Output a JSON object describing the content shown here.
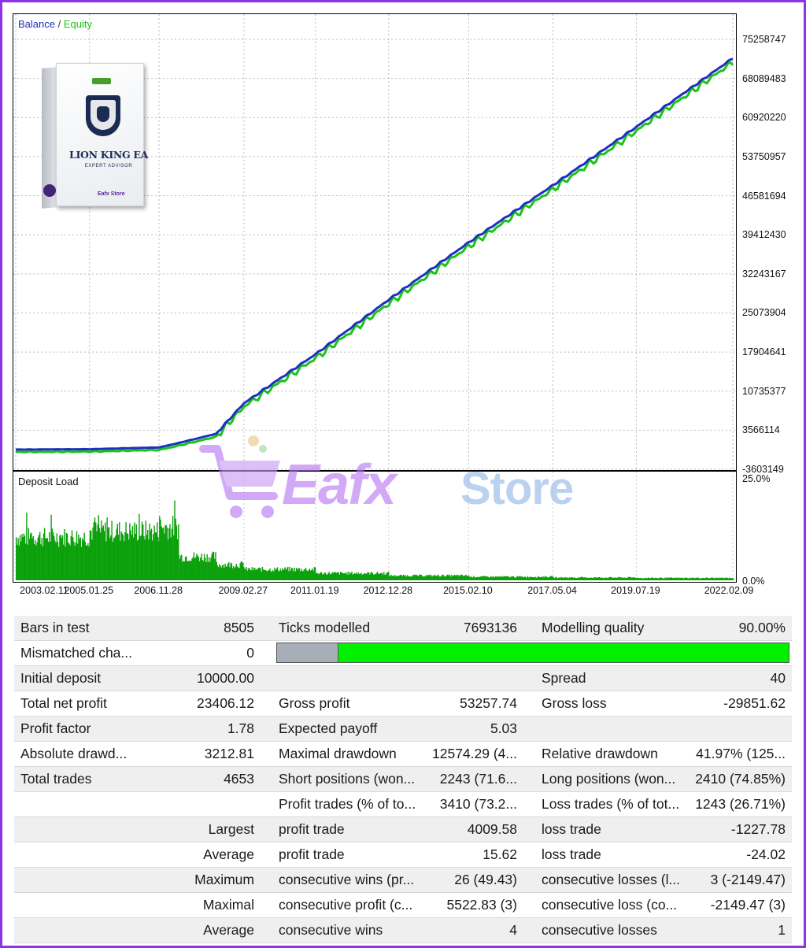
{
  "main_chart": {
    "legend": {
      "balance": "Balance",
      "separator": "/",
      "equity": "Equity"
    },
    "y_ticks": [
      "75258747",
      "68089483",
      "60920220",
      "53750957",
      "46581694",
      "39412430",
      "32243167",
      "25073904",
      "17904641",
      "10735377",
      "3566114",
      "-3603149"
    ],
    "colors": {
      "balance": "#1f2fbf",
      "equity": "#18c418"
    }
  },
  "chart_data": [
    {
      "type": "line",
      "title": "",
      "series": [
        {
          "name": "Balance",
          "x": [
            "2003.02.11",
            "2005.01.25",
            "2006.11.28",
            "2007.06",
            "2008.06",
            "2009.02.27",
            "2011.01.19",
            "2012.12.28",
            "2015.02.10",
            "2017.05.04",
            "2019.07.19",
            "2022.02.09"
          ],
          "values": [
            10000,
            80000,
            400000,
            1200000,
            2900000,
            8500000,
            17500000,
            27500000,
            38000000,
            48500000,
            59200000,
            71800000
          ]
        },
        {
          "name": "Equity",
          "x": [
            "2003.02.11",
            "2005.01.25",
            "2006.11.28",
            "2007.06",
            "2008.06",
            "2009.02.27",
            "2011.01.19",
            "2012.12.28",
            "2015.02.10",
            "2017.05.04",
            "2019.07.19",
            "2022.02.09"
          ],
          "values": [
            10000,
            80000,
            380000,
            1150000,
            2800000,
            8300000,
            17200000,
            27200000,
            37700000,
            48200000,
            58900000,
            71500000
          ]
        }
      ],
      "ylim": [
        -3603149,
        78000000
      ]
    },
    {
      "type": "bar",
      "title": "Deposit Load",
      "x_range": [
        "2003.02.11",
        "2022.02.09"
      ],
      "ylim": [
        0,
        25
      ],
      "y_ticks": [
        "25.0%",
        "0.0%"
      ],
      "segments_pct": [
        {
          "from": "2003.02.11",
          "to": "2005.01.25",
          "level": 11
        },
        {
          "from": "2005.01.25",
          "to": "2006.11.28",
          "level": 12.5
        },
        {
          "from": "2006.11.28",
          "to": "2007.06",
          "level": 13.5
        },
        {
          "from": "2007.06",
          "to": "2008.06",
          "level": 6
        },
        {
          "from": "2008.06",
          "to": "2009.02.27",
          "level": 4
        },
        {
          "from": "2009.02.27",
          "to": "2011.01.19",
          "level": 2.8
        },
        {
          "from": "2011.01.19",
          "to": "2012.12.28",
          "level": 1.8
        },
        {
          "from": "2012.12.28",
          "to": "2015.02.10",
          "level": 1.2
        },
        {
          "from": "2015.02.10",
          "to": "2017.05.04",
          "level": 0.9
        },
        {
          "from": "2017.05.04",
          "to": "2019.07.19",
          "level": 0.7
        },
        {
          "from": "2019.07.19",
          "to": "2022.02.09",
          "level": 0.6
        }
      ],
      "bar_color": "#0aa00a"
    }
  ],
  "deposit_load": {
    "legend": "Deposit Load",
    "y_ticks": [
      "25.0%",
      "0.0%"
    ]
  },
  "x_axis": [
    "2003.02.11",
    "2005.01.25",
    "2006.11.28",
    "2009.02.27",
    "2011.01.19",
    "2012.12.28",
    "2015.02.10",
    "2017.05.04",
    "2019.07.19",
    "2022.02.09"
  ],
  "product": {
    "title": "LION KING EA",
    "subtitle": "EXPERT ADVISOR",
    "brand": "Eafx Store"
  },
  "watermark": {
    "part1": "Eafx",
    "part2": "Store"
  },
  "stats": {
    "bars_in_test": {
      "label": "Bars in test",
      "value": "8505"
    },
    "ticks_modelled": {
      "label": "Ticks modelled",
      "value": "7693136"
    },
    "modelling_quality": {
      "label": "Modelling quality",
      "value": "90.00%"
    },
    "mismatched": {
      "label": "Mismatched cha...",
      "value": "0"
    },
    "quality_fraction": 0.9,
    "initial_deposit": {
      "label": "Initial deposit",
      "value": "10000.00"
    },
    "spread": {
      "label": "Spread",
      "value": "40"
    },
    "total_net_profit": {
      "label": "Total net profit",
      "value": "23406.12"
    },
    "gross_profit": {
      "label": "Gross profit",
      "value": "53257.74"
    },
    "gross_loss": {
      "label": "Gross loss",
      "value": "-29851.62"
    },
    "profit_factor": {
      "label": "Profit factor",
      "value": "1.78"
    },
    "expected_payoff": {
      "label": "Expected payoff",
      "value": "5.03"
    },
    "absolute_drawdown": {
      "label": "Absolute drawd...",
      "value": "3212.81"
    },
    "maximal_drawdown": {
      "label": "Maximal drawdown",
      "value": "12574.29 (4..."
    },
    "relative_drawdown": {
      "label": "Relative drawdown",
      "value": "41.97% (125..."
    },
    "total_trades": {
      "label": "Total trades",
      "value": "4653"
    },
    "short_positions": {
      "label": "Short positions (won...",
      "value": "2243 (71.6..."
    },
    "long_positions": {
      "label": "Long positions (won...",
      "value": "2410 (74.85%)"
    },
    "profit_trades": {
      "label": "Profit trades (% of to...",
      "value": "3410 (73.2..."
    },
    "loss_trades": {
      "label": "Loss trades (% of tot...",
      "value": "1243 (26.71%)"
    },
    "largest": {
      "label": "Largest",
      "profit_label": "profit trade",
      "profit_value": "4009.58",
      "loss_label": "loss trade",
      "loss_value": "-1227.78"
    },
    "average": {
      "label": "Average",
      "profit_label": "profit trade",
      "profit_value": "15.62",
      "loss_label": "loss trade",
      "loss_value": "-24.02"
    },
    "maximum": {
      "label": "Maximum",
      "profit_label": "consecutive wins (pr...",
      "profit_value": "26 (49.43)",
      "loss_label": "consecutive losses (l...",
      "loss_value": "3 (-2149.47)"
    },
    "maximal": {
      "label": "Maximal",
      "profit_label": "consecutive profit (c...",
      "profit_value": "5522.83 (3)",
      "loss_label": "consecutive loss (co...",
      "loss_value": "-2149.47 (3)"
    },
    "average2": {
      "label": "Average",
      "profit_label": "consecutive wins",
      "profit_value": "4",
      "loss_label": "consecutive losses",
      "loss_value": "1"
    }
  }
}
